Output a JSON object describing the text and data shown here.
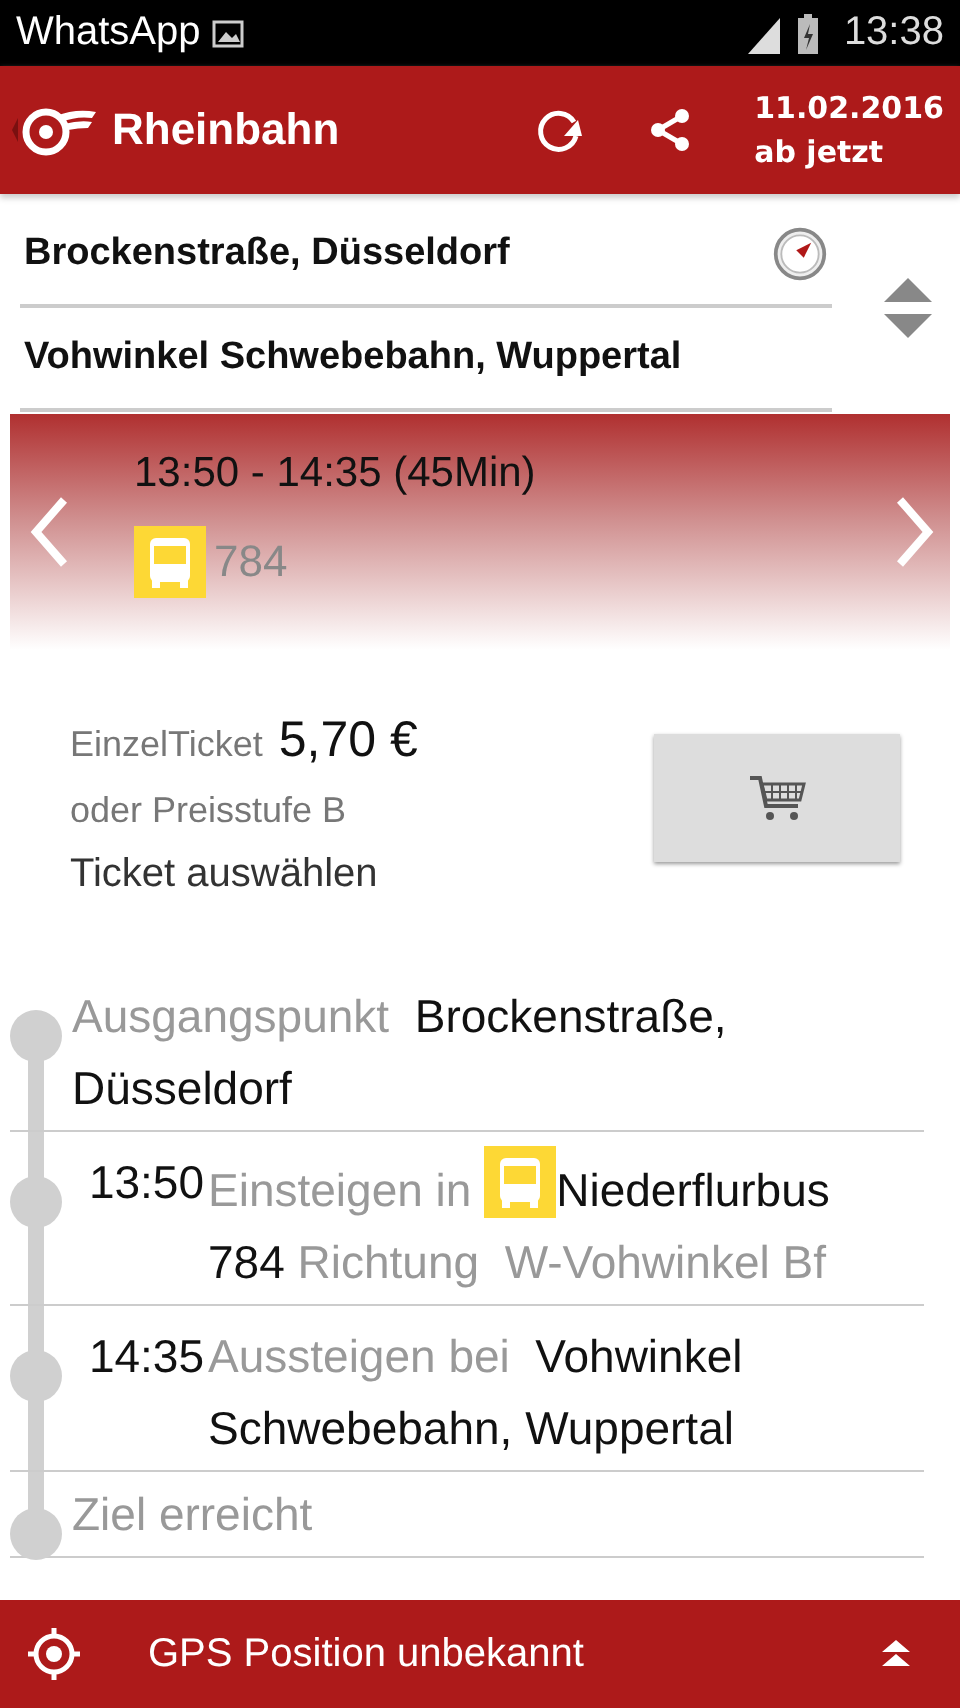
{
  "status_bar": {
    "app": "WhatsApp",
    "time": "13:38"
  },
  "header": {
    "title": "Rheinbahn",
    "date": "11.02.2016",
    "time_label": "ab jetzt"
  },
  "from": {
    "value": "Brockenstraße, Düsseldorf"
  },
  "to": {
    "value": "Vohwinkel Schwebebahn, Wuppertal"
  },
  "connection": {
    "times": "13:50 - 14:35 (45Min)",
    "line": "784"
  },
  "ticket": {
    "label": "EinzelTicket",
    "price": "5,70 €",
    "tariff": "oder Preisstufe B",
    "link": "Ticket auswählen"
  },
  "steps": [
    {
      "kind": "start",
      "label": "Ausgangspunkt",
      "place": "Brockenstraße, Düsseldorf"
    },
    {
      "kind": "board",
      "time": "13:50",
      "label": "Einsteigen in",
      "vehicle": "Niederflurbus 784",
      "direction_label": "Richtung",
      "direction": "W-Vohwinkel Bf"
    },
    {
      "kind": "alight",
      "time": "14:35",
      "label": "Aussteigen bei",
      "place": "Vohwinkel Schwebebahn, Wuppertal"
    },
    {
      "kind": "end",
      "label": "Ziel erreicht"
    }
  ],
  "footer": {
    "gps": "GPS Position unbekannt"
  }
}
